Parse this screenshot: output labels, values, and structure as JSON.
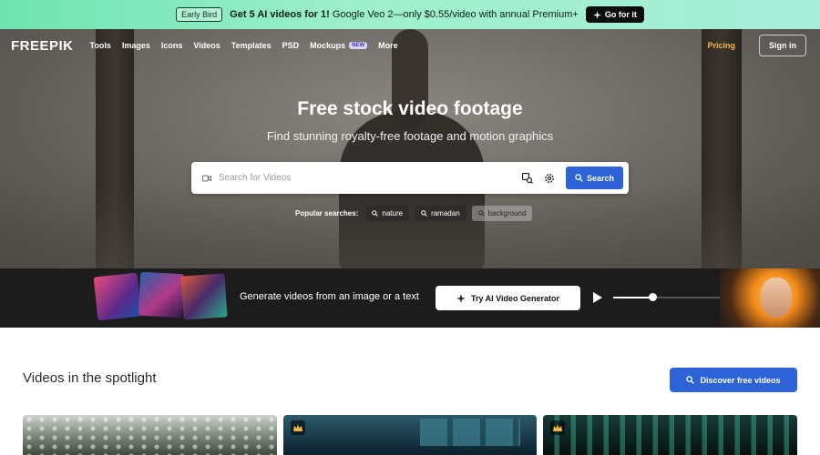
{
  "promo": {
    "badge": "Early Bird",
    "highlight": "Get 5 AI videos for 1!",
    "text": " Google Veo 2—only $0.55/video with annual Premium+",
    "cta": "Go for it"
  },
  "nav": {
    "logo": "FREEPIK",
    "items": [
      "Tools",
      "Images",
      "Icons",
      "Videos",
      "Templates",
      "PSD",
      "Mockups",
      "More"
    ],
    "new_tag": "NEW",
    "pricing": "Pricing",
    "signin": "Sign in"
  },
  "hero": {
    "title": "Free stock video footage",
    "subtitle": "Find stunning royalty-free footage and motion graphics",
    "search_placeholder": "Search for Videos",
    "search_button": "Search",
    "popular_label": "Popular searches:",
    "popular": [
      "nature",
      "ramadan",
      "background"
    ]
  },
  "banner": {
    "text": "Generate videos from an image or a text",
    "cta": "Try AI Video Generator",
    "progress": 0.36
  },
  "spotlight": {
    "title": "Videos in the spotlight",
    "cta": "Discover free videos"
  },
  "colors": {
    "accent": "#2e63d8",
    "pricing": "#f5b942",
    "promo_bg": "#9ef0cc"
  }
}
